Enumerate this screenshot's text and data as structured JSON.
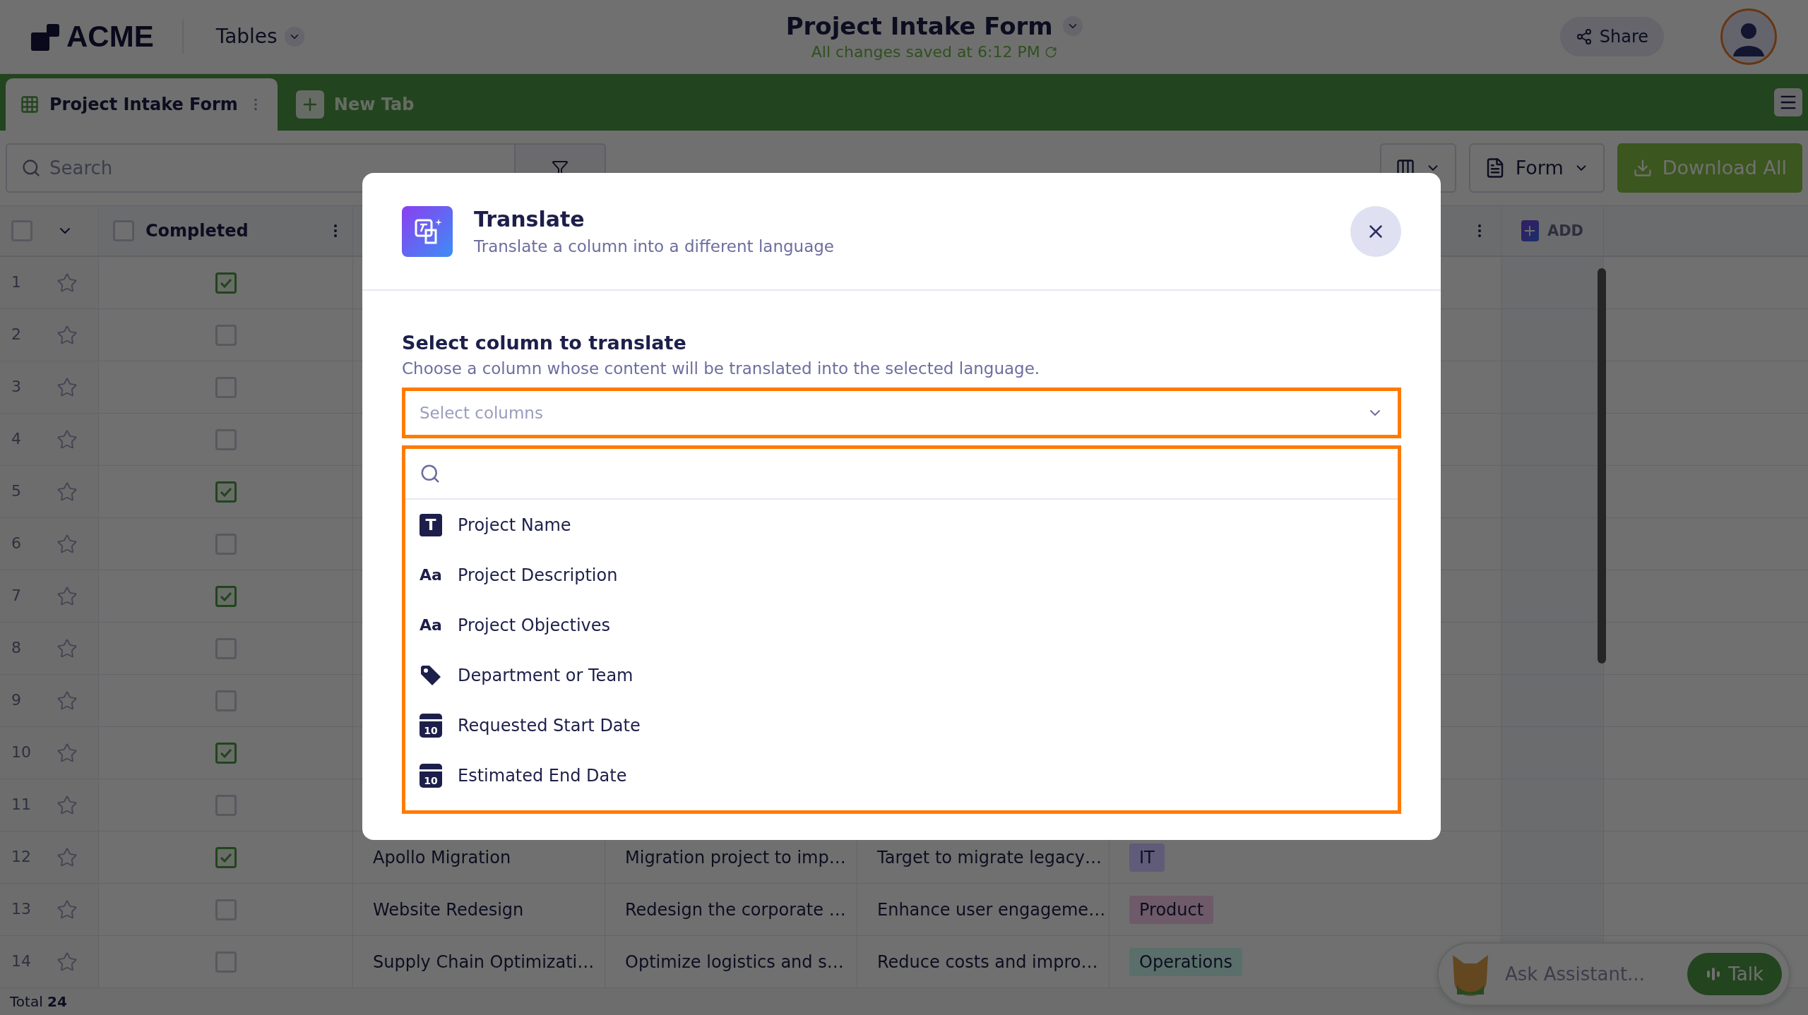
{
  "header": {
    "logo": "ACME",
    "menu": "Tables",
    "title": "Project Intake Form",
    "status": "All changes saved at 6:12 PM",
    "share": "Share"
  },
  "tabs": [
    {
      "label": "Project Intake Form",
      "selected": true
    }
  ],
  "new_tab": "New Tab",
  "toolbar": {
    "search_placeholder": "Search",
    "form": "Form",
    "download": "Download All"
  },
  "table": {
    "select_all": {
      "checked": false
    },
    "completed_header": "Completed",
    "add_header": "ADD",
    "total": "Total **24**",
    "rows": [
      {
        "number": "1",
        "completed": true
      },
      {
        "number": "2",
        "completed": false
      },
      {
        "number": "3",
        "completed": false
      },
      {
        "number": "4",
        "completed": false
      },
      {
        "number": "5",
        "completed": true
      },
      {
        "number": "6",
        "completed": false
      },
      {
        "number": "7",
        "completed": true
      },
      {
        "number": "8",
        "completed": false
      },
      {
        "number": "9",
        "completed": false
      },
      {
        "number": "10",
        "completed": true
      },
      {
        "number": "11",
        "completed": false
      },
      {
        "number": "12",
        "completed": true,
        "name": "Apollo Migration",
        "description": "Migration project to imp…",
        "objectives": "Target to migrate legacy…",
        "department": {
          "label": "IT",
          "color": "#5f5b78"
        }
      },
      {
        "number": "13",
        "completed": false,
        "name": "Website Redesign",
        "description": "Redesign the corporate …",
        "objectives": "Enhance user engageme…",
        "department": {
          "label": "Product",
          "color": "#6e5a68"
        }
      },
      {
        "number": "14",
        "completed": false,
        "name": "Supply Chain Optimizati…",
        "description": "Optimize logistics and s…",
        "objectives": "Reduce costs and impro…",
        "department": {
          "label": "Operations",
          "color": "#5a6f6a"
        }
      }
    ]
  },
  "assistant": {
    "placeholder": "Ask Assistant...",
    "talk": "Talk"
  },
  "modal": {
    "title": "Translate",
    "subtitle": "Translate a column into a different language",
    "section_title": "Select column to translate",
    "section_description": "Choose a column whose content will be translated into the selected language.",
    "select_placeholder": "Select columns",
    "options": [
      {
        "kind": "text",
        "icon_text": "T",
        "label": "Project Name"
      },
      {
        "kind": "paragraph",
        "icon_text": "Aa",
        "label": "Project Description"
      },
      {
        "kind": "paragraph",
        "icon_text": "Aa",
        "label": "Project Objectives"
      },
      {
        "kind": "tag",
        "label": "Department or Team"
      },
      {
        "kind": "date",
        "icon_text": "10",
        "label": "Requested Start Date"
      },
      {
        "kind": "date",
        "icon_text": "10",
        "label": "Estimated End Date"
      }
    ]
  }
}
